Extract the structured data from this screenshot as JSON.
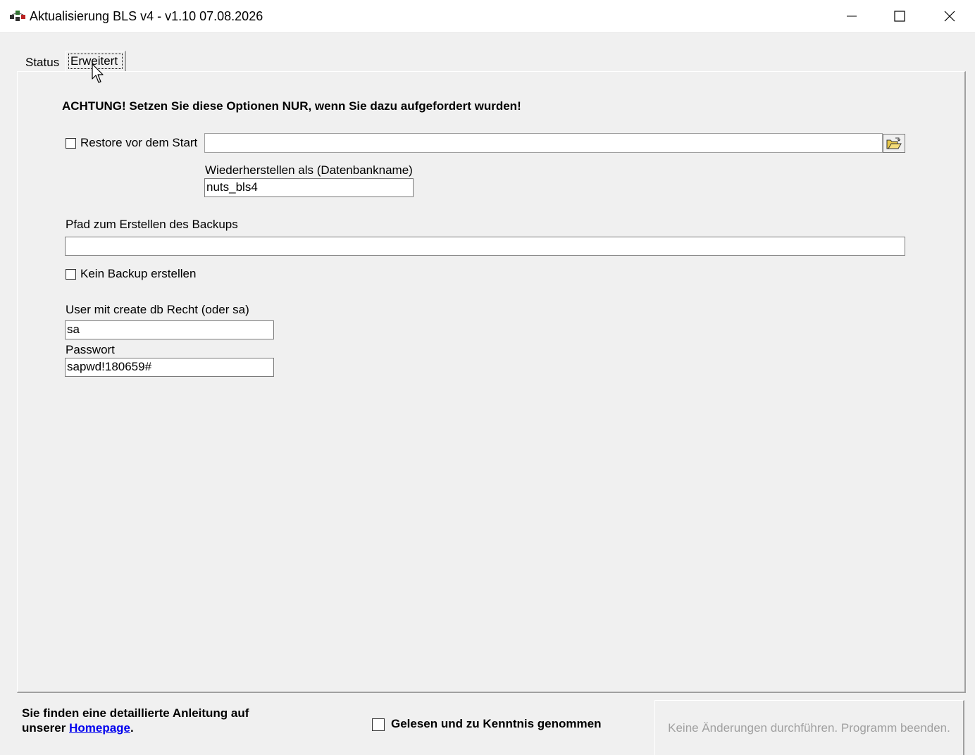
{
  "window": {
    "title": "Aktualisierung BLS v4 - v1.10 07.08.2026",
    "controls": [
      "minimize-icon",
      "maximize-icon",
      "close-icon"
    ]
  },
  "tabs": [
    {
      "label": "Status",
      "selected": false
    },
    {
      "label": "Erweitert",
      "selected": true
    }
  ],
  "advanced": {
    "warning": "ACHTUNG! Setzen Sie diese Optionen NUR, wenn Sie dazu aufgefordert wurden!",
    "restore": {
      "checkbox_label": "Restore vor dem Start",
      "checked": false,
      "path_value": "",
      "browse_icon": "folder-open-icon"
    },
    "restore_as": {
      "label": "Wiederherstellen als (Datenbankname)",
      "value": "nuts_bls4"
    },
    "backup_path": {
      "label": "Pfad zum Erstellen des Backups",
      "value": ""
    },
    "no_backup": {
      "checkbox_label": "Kein Backup erstellen",
      "checked": false
    },
    "user": {
      "label": "User mit create db Recht (oder sa)",
      "value": "sa"
    },
    "password": {
      "label": "Passwort",
      "value": "sapwd!180659#"
    }
  },
  "footer": {
    "info_line1": "Sie finden eine detaillierte Anleitung auf",
    "info_line2_prefix": "unserer ",
    "info_link": "Homepage",
    "info_line2_suffix": ".",
    "confirm_label": "Gelesen und zu Kenntnis genommen",
    "confirm_checked": false,
    "exit_button": "Keine Änderungen durchführen. Programm beenden.",
    "exit_button_enabled": false
  }
}
